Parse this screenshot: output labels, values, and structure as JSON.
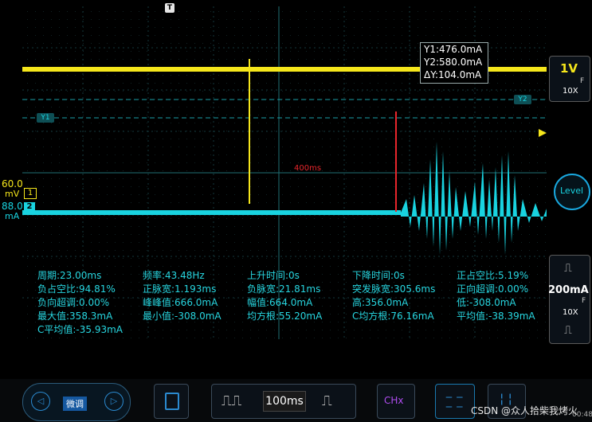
{
  "top_marker": "T",
  "cursor_readout": {
    "y1": "Y1:476.0mA",
    "y2": "Y2:580.0mA",
    "dy": "ΔY:104.0mA"
  },
  "cursor_tags": {
    "y1": "Y1",
    "y2": "Y2"
  },
  "time_annotation": "400ms",
  "ch1": {
    "offset_top": "60.0",
    "offset_bottom": "mV",
    "marker": "1"
  },
  "ch2": {
    "offset_top": "88.0",
    "offset_bottom": "mA",
    "marker": "2"
  },
  "right_panel": {
    "ch1_scale": "1V",
    "ch1_coupling": "F",
    "ch1_probe": "10X",
    "level_label": "Level",
    "ch2_scale": "200mA",
    "ch2_coupling": "F",
    "ch2_probe": "10X"
  },
  "measurements": [
    [
      "周期:23.00ms",
      "频率:43.48Hz",
      "上升时间:0s",
      "下降时间:0s",
      "正占空比:5.19%"
    ],
    [
      "负占空比:94.81%",
      "正脉宽:1.193ms",
      "负脉宽:21.81ms",
      "突发脉宽:305.6ms",
      "正向超调:0.00%"
    ],
    [
      "负向超调:0.00%",
      "峰峰值:666.0mA",
      "幅值:664.0mA",
      "高:356.0mA",
      "低:-308.0mA"
    ],
    [
      "最大值:358.3mA",
      "最小值:-308.0mA",
      "均方根:55.20mA",
      "C均方根:76.16mA",
      "平均值:-38.39mA"
    ],
    [
      "C平均值:-35.93mA"
    ]
  ],
  "bottom_bar": {
    "fine_label": "微调",
    "timebase": "100ms",
    "chx_label": "CHx",
    "clock": "00:48"
  },
  "watermark": "CSDN @众人拾柴我烤火",
  "colors": {
    "ch1": "#f5e61b",
    "ch2": "#19d3e0",
    "cursor": "#e8262c",
    "grid": "#1f6f74"
  }
}
